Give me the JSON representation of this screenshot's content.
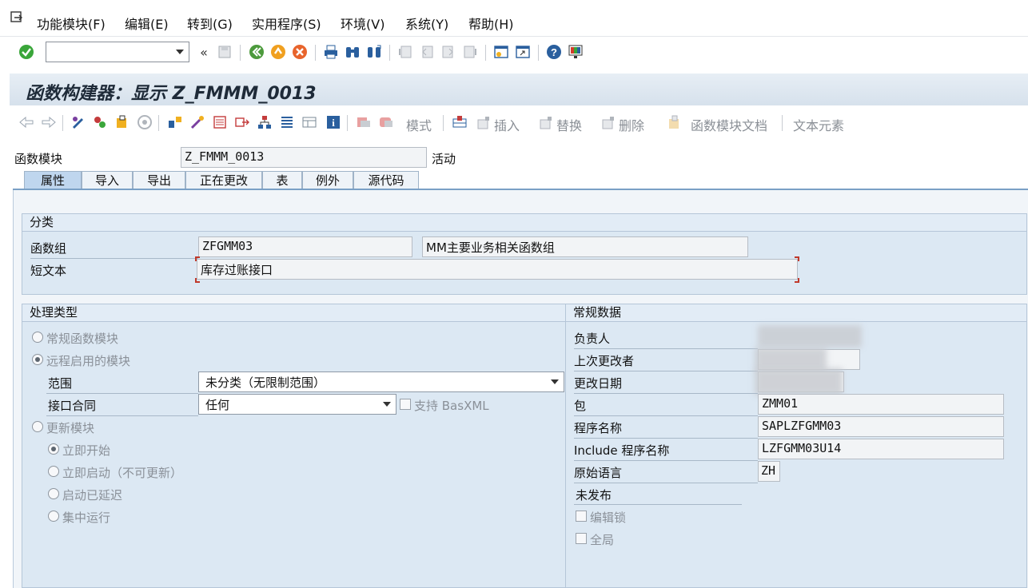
{
  "menubar": {
    "items": [
      "功能模块(F)",
      "编辑(E)",
      "转到(G)",
      "实用程序(S)",
      "环境(V)",
      "系统(Y)",
      "帮助(H)"
    ]
  },
  "title": "函数构建器：显示 Z_FMMM_0013",
  "app_toolbar": {
    "mode_label": "模式",
    "insert_label": "插入",
    "replace_label": "替换",
    "delete_label": "删除",
    "fm_doc_label": "函数模块文档",
    "text_elements_label": "文本元素"
  },
  "header": {
    "fm_label": "函数模块",
    "fm_value": "Z_FMMM_0013",
    "status": "活动"
  },
  "tabs": [
    "属性",
    "导入",
    "导出",
    "正在更改",
    "表",
    "例外",
    "源代码"
  ],
  "active_tab": "属性",
  "classification": {
    "title": "分类",
    "group_label": "函数组",
    "group_value": "ZFGMM03",
    "group_desc": "MM主要业务相关函数组",
    "short_text_label": "短文本",
    "short_text_value": "库存过账接口"
  },
  "processing": {
    "title": "处理类型",
    "normal": "常规函数模块",
    "remote": "远程启用的模块",
    "scope_label": "范围",
    "scope_value": "未分类（无限制范围）",
    "contract_label": "接口合同",
    "contract_value": "任何",
    "basxml_label": "支持 BasXML",
    "update": "更新模块",
    "immediate_start": "立即开始",
    "immediate_no_update": "立即启动（不可更新）",
    "delayed": "启动已延迟",
    "collective": "集中运行",
    "selected": "remote"
  },
  "general": {
    "title": "常规数据",
    "owner_label": "负责人",
    "last_changed_by_label": "上次更改者",
    "changed_on_label": "更改日期",
    "package_label": "包",
    "package_value": "ZMM01",
    "program_label": "程序名称",
    "program_value": "SAPLZFGMM03",
    "include_label": "Include 程序名称",
    "include_value": "LZFGMM03U14",
    "language_label": "原始语言",
    "language_value": "ZH",
    "release_status": "未发布",
    "edit_lock_label": "编辑锁",
    "global_label": "全局"
  },
  "colors": {
    "accent": "#3a78c4",
    "panel": "#dce8f3",
    "ok_green": "#3aa63a"
  }
}
